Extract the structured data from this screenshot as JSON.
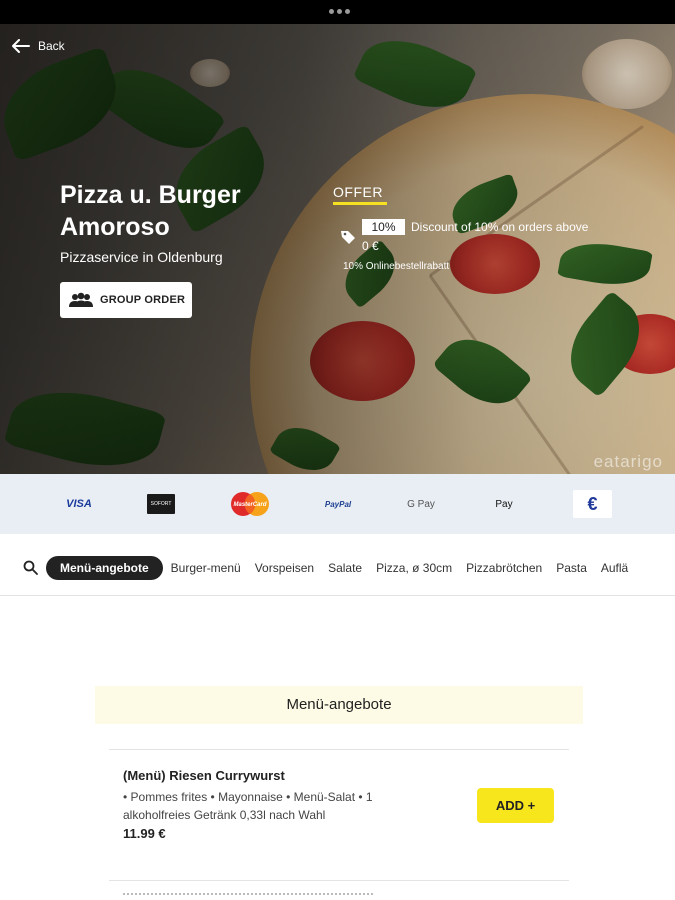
{
  "header": {
    "back_label": "Back"
  },
  "restaurant": {
    "name": "Pizza u. Burger Amoroso",
    "subtitle": "Pizzaservice in Oldenburg",
    "group_order_label": "GROUP ORDER"
  },
  "offer": {
    "heading": "OFFER",
    "percent_badge": "10%",
    "description": "Discount of 10% on orders above",
    "threshold": "0 €",
    "name": "10% Onlinebestellrabatt"
  },
  "hero_watermark": "eatarigo",
  "payments": {
    "methods": [
      "visa-logo",
      "sofort-logo",
      "mastercard-logo",
      "paypal-logo",
      "google-pay-logo",
      "apple-pay-logo",
      "cash-euro-icon"
    ],
    "visa": "VISA",
    "sofort": "SOFORT",
    "mastercard": "MasterCard",
    "paypal": "PayPal",
    "gpay": "G Pay",
    "applepay": " Pay",
    "euro": "€"
  },
  "categories": {
    "items": [
      "Menü-angebote",
      "Burger-menü",
      "Vorspeisen",
      "Salate",
      "Pizza, ø 30cm",
      "Pizzabrötchen",
      "Pasta",
      "Auflä"
    ]
  },
  "section": {
    "title": "Menü-angebote"
  },
  "items": [
    {
      "name": "(Menü) Riesen Currywurst",
      "description": "• Pommes frites • Mayonnaise • Menü-Salat • 1 alkoholfreies Getränk 0,33l nach Wahl",
      "price": "11.99 €",
      "add_label": "ADD +"
    }
  ],
  "colors": {
    "accent_yellow": "#f8e61c",
    "section_bg": "#fdfae5",
    "payments_bg": "#e9eef5",
    "active_tab": "#222222"
  }
}
